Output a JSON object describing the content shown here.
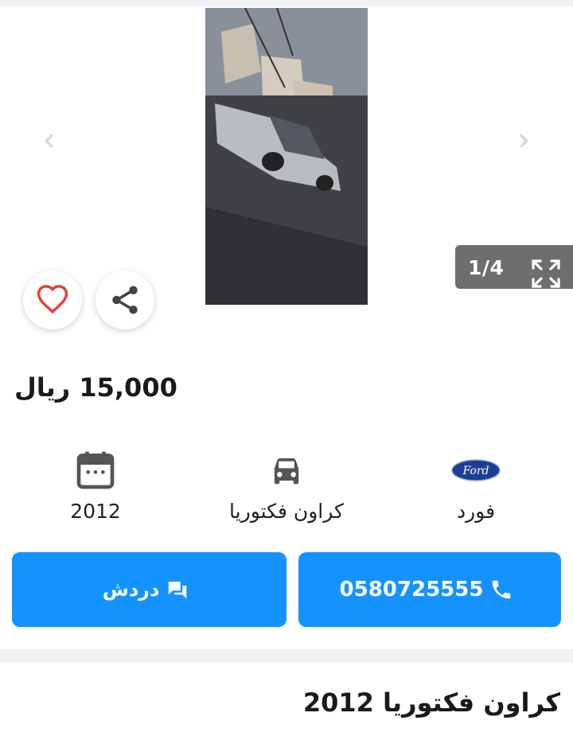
{
  "gallery": {
    "counter": "1/4",
    "prev_icon": "chevron-left-icon",
    "next_icon": "chevron-right-icon",
    "fullscreen_icon": "fullscreen-icon"
  },
  "actions": {
    "favorite_icon": "heart-icon",
    "share_icon": "share-icon"
  },
  "price": "15,000 ريال",
  "specs": {
    "year": "2012",
    "model": "كراون فكتوريا",
    "brand": "فورد",
    "brand_logo_text": "Ford"
  },
  "buttons": {
    "chat_label": "دردش",
    "phone_label": "0580725555"
  },
  "listing_title": "كراون فكتوريا 2012",
  "colors": {
    "primary": "#1493ff",
    "heart": "#e0433b",
    "ford_blue": "#1c3f94"
  }
}
